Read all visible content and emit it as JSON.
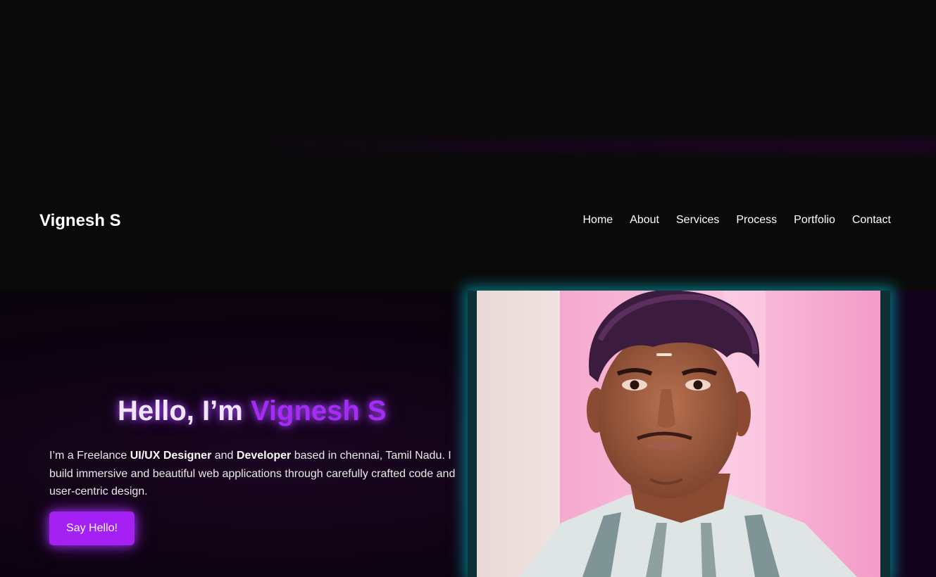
{
  "header": {
    "brand": "Vignesh S",
    "nav": [
      "Home",
      "About",
      "Services",
      "Process",
      "Portfolio",
      "Contact"
    ]
  },
  "hero": {
    "greeting": "Hello, I’m ",
    "name": "Vignesh S",
    "desc_1": "I’m a Freelance ",
    "desc_role1": "UI/UX Designer",
    "desc_2": " and ",
    "desc_role2": "Developer",
    "desc_3": " based in chennai, Tamil Nadu. I build immersive and beautiful web applications through carefully crafted code and user-centric design.",
    "cta": "Say Hello!"
  },
  "colors": {
    "accent": "#a52cf6",
    "button": "#a521f3",
    "frame_glow": "#00c8dc",
    "background": "#0a0a0a"
  }
}
